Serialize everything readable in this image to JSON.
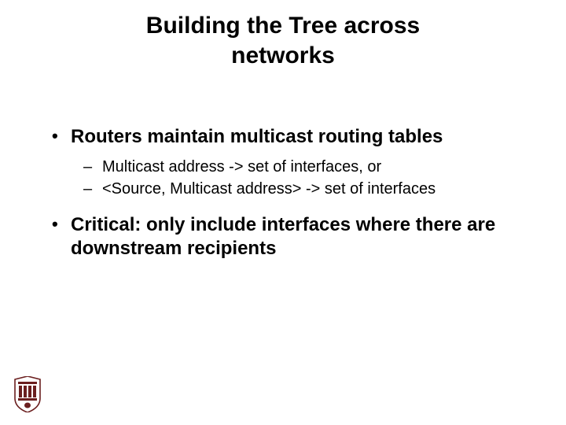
{
  "title_line1": "Building the Tree across",
  "title_line2": "networks",
  "bullets": {
    "b1": "Routers maintain multicast routing tables",
    "b1_sub1": "Multicast address -> set of interfaces, or",
    "b1_sub2": "<Source, Multicast address> -> set of interfaces",
    "b2": "Critical: only include interfaces where there are downstream recipients"
  }
}
